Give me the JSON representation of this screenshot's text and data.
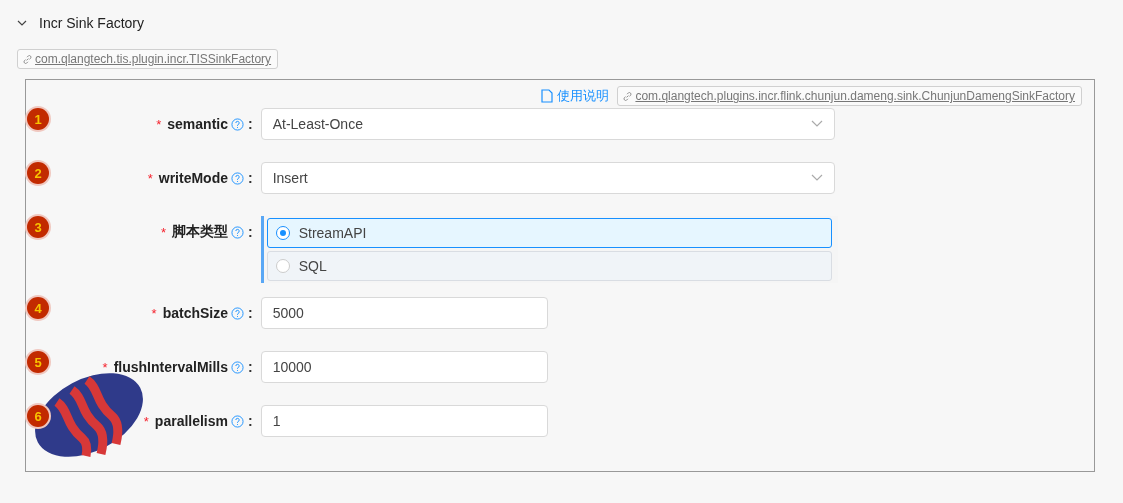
{
  "section": {
    "title": "Incr Sink Factory",
    "expanded": true,
    "plugin_tag": "com.qlangtech.tis.plugin.incr.TISSinkFactory"
  },
  "form": {
    "doc_link": "使用说明",
    "impl_tag": "com.qlangtech.plugins.incr.flink.chunjun.dameng.sink.ChunjunDamengSinkFactory",
    "fields": [
      {
        "badge": "1",
        "required_mark": "*",
        "label": "semantic",
        "separator": ":",
        "kind": "select",
        "value": "At-Least-Once"
      },
      {
        "badge": "2",
        "required_mark": "*",
        "label": "writeMode",
        "separator": ":",
        "kind": "select",
        "value": "Insert"
      },
      {
        "badge": "3",
        "required_mark": "*",
        "label": "脚本类型",
        "separator": ":",
        "kind": "radio",
        "options": [
          {
            "label": "StreamAPI",
            "selected": true
          },
          {
            "label": "SQL",
            "selected": false
          }
        ]
      },
      {
        "badge": "4",
        "required_mark": "*",
        "label": "batchSize",
        "separator": ":",
        "kind": "input",
        "value": "5000"
      },
      {
        "badge": "5",
        "required_mark": "*",
        "label": "flushIntervalMills",
        "separator": ":",
        "kind": "input",
        "value": "10000"
      },
      {
        "badge": "6",
        "required_mark": "*",
        "label": "parallelism",
        "separator": ":",
        "kind": "input",
        "value": "1"
      }
    ]
  }
}
